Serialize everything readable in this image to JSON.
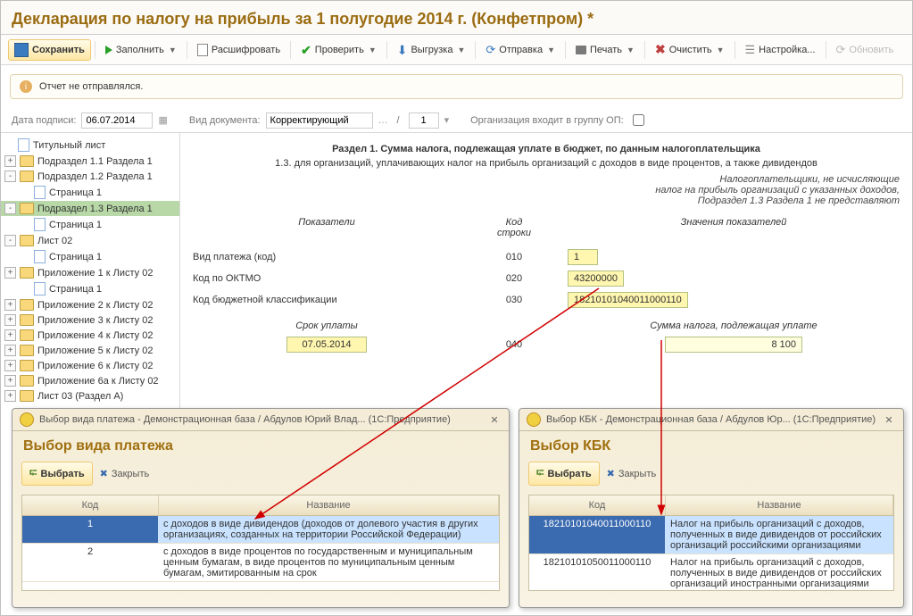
{
  "title": "Декларация по налогу на прибыль за 1 полугодие 2014 г. (Конфетпром) *",
  "toolbar": {
    "save": "Сохранить",
    "fill": "Заполнить",
    "decode": "Расшифровать",
    "check": "Проверить",
    "export": "Выгрузка",
    "send": "Отправка",
    "print": "Печать",
    "clear": "Очистить",
    "setup": "Настройка...",
    "refresh": "Обновить"
  },
  "banner": "Отчет не отправлялся.",
  "meta": {
    "sign_label": "Дата подписи:",
    "sign_date": "06.07.2014",
    "doc_label": "Вид документа:",
    "doc_type": "Корректирующий",
    "slash": "/",
    "num": "1",
    "org_in_grp": "Организация входит в группу ОП:"
  },
  "tree": [
    {
      "exp": null,
      "icon": "page",
      "label": "Титульный лист",
      "depth": 0
    },
    {
      "exp": "+",
      "icon": "fold",
      "label": "Подраздел 1.1 Раздела 1",
      "depth": 0
    },
    {
      "exp": "-",
      "icon": "fold",
      "label": "Подраздел 1.2 Раздела 1",
      "depth": 0
    },
    {
      "exp": null,
      "icon": "page",
      "label": "Страница 1",
      "depth": 1
    },
    {
      "exp": "-",
      "icon": "fold",
      "label": "Подраздел 1.3 Раздела 1",
      "depth": 0,
      "sel": true
    },
    {
      "exp": null,
      "icon": "page",
      "label": "Страница 1",
      "depth": 1
    },
    {
      "exp": "-",
      "icon": "fold",
      "label": "Лист 02",
      "depth": 0
    },
    {
      "exp": null,
      "icon": "page",
      "label": "Страница 1",
      "depth": 1
    },
    {
      "exp": "+",
      "icon": "fold",
      "label": "Приложение 1 к Листу 02",
      "depth": 0
    },
    {
      "exp": null,
      "icon": "page",
      "label": "Страница 1",
      "depth": 1
    },
    {
      "exp": "+",
      "icon": "fold",
      "label": "Приложение 2 к Листу 02",
      "depth": 0
    },
    {
      "exp": "+",
      "icon": "fold",
      "label": "Приложение 3 к Листу 02",
      "depth": 0
    },
    {
      "exp": "+",
      "icon": "fold",
      "label": "Приложение 4 к Листу 02",
      "depth": 0
    },
    {
      "exp": "+",
      "icon": "fold",
      "label": "Приложение 5 к Листу 02",
      "depth": 0
    },
    {
      "exp": "+",
      "icon": "fold",
      "label": "Приложение 6 к Листу 02",
      "depth": 0
    },
    {
      "exp": "+",
      "icon": "fold",
      "label": "Приложение 6а к Листу 02",
      "depth": 0
    },
    {
      "exp": "+",
      "icon": "fold",
      "label": "Лист 03 (Раздел А)",
      "depth": 0
    }
  ],
  "content": {
    "h1": "Раздел 1. Сумма налога, подлежащая уплате в бюджет, по данным налогоплательщика",
    "sub": "1.3. для организаций, уплачивающих налог на прибыль организаций с доходов в виде процентов, а также дивидендов",
    "note": "Налогоплательщики, не исчисляющие\nналог на прибыль организаций с указанных доходов,\nПодраздел 1.3 Раздела 1 не представляют",
    "hdr_ind": "Показатели",
    "hdr_code": "Код\nстроки",
    "hdr_val": "Значения показателей",
    "r1_lab": "Вид платежа (код)",
    "r1_code": "010",
    "r1_val": "1",
    "r2_lab": "Код по ОКТМО",
    "r2_code": "020",
    "r2_val": "43200000",
    "r3_lab": "Код бюджетной классификации",
    "r3_code": "030",
    "r3_val": "18210101040011000110",
    "sub_l": "Срок уплаты",
    "sub_r": "Сумма налога, подлежащая уплате",
    "r4_date": "07.05.2014",
    "r4_code": "040",
    "r4_val": "8 100"
  },
  "dlg1": {
    "caption": "Выбор вида платежа - Демонстрационная база / Абдулов Юрий Влад...   (1С:Предприятие)",
    "title": "Выбор вида платежа",
    "select": "Выбрать",
    "close": "Закрыть",
    "col_code": "Код",
    "col_name": "Название",
    "rows": [
      {
        "code": "1",
        "name": "с доходов в виде дивидендов (доходов от долевого участия в других организациях, созданных на территории Российской Федерации)",
        "sel": true
      },
      {
        "code": "2",
        "name": "с доходов в виде процентов по государственным и муниципальным ценным бумагам, в виде процентов по муниципальным ценным бумагам, эмитированным на срок"
      }
    ]
  },
  "dlg2": {
    "caption": "Выбор КБК - Демонстрационная база / Абдулов Юр...   (1С:Предприятие)",
    "title": "Выбор КБК",
    "select": "Выбрать",
    "close": "Закрыть",
    "col_code": "Код",
    "col_name": "Название",
    "rows": [
      {
        "code": "18210101040011000110",
        "name": "Налог на прибыль организаций с доходов, полученных в виде дивидендов от российских организаций российскими организациями",
        "sel": true
      },
      {
        "code": "18210101050011000110",
        "name": "Налог на прибыль организаций с доходов, полученных в виде дивидендов от российских организаций иностранными организациями"
      }
    ]
  }
}
